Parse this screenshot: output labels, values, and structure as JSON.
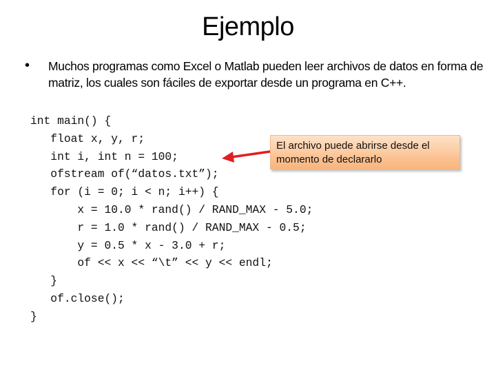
{
  "slide": {
    "title": "Ejemplo",
    "bullet_symbol": "•",
    "bullet_text": "Muchos programas como Excel o Matlab pueden leer archivos de datos en forma de matriz, los cuales son fáciles de exportar desde un programa en C++."
  },
  "code": {
    "lines": [
      "int main() {",
      "   float x, y, r;",
      "   int i, int n = 100;",
      "   ofstream of(“datos.txt”);",
      "   for (i = 0; i < n; i++) {",
      "       x = 10.0 * rand() / RAND_MAX - 5.0;",
      "       r = 1.0 * rand() / RAND_MAX - 0.5;",
      "       y = 0.5 * x - 3.0 + r;",
      "       of << x << “\\t” << y << endl;",
      "   }",
      "   of.close();",
      "}"
    ]
  },
  "callout": {
    "line1": "El archivo puede abrirse desde el",
    "line2": "momento de declararlo",
    "arrow_color": "#e02020",
    "fill_top": "#fde2c8",
    "fill_bottom": "#f9b47c"
  }
}
